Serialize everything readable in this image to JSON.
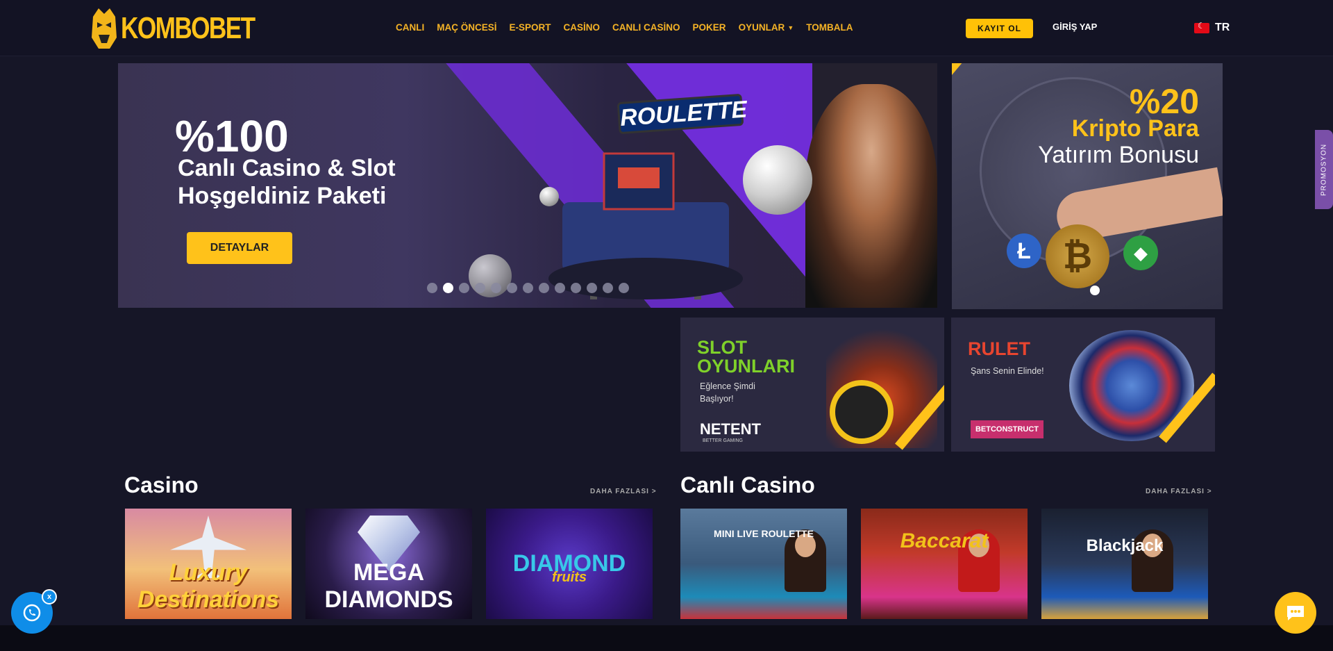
{
  "header": {
    "logo_text": "KOMBOBET",
    "nav": [
      {
        "label": "CANLI"
      },
      {
        "label": "MAÇ ÖNCESİ"
      },
      {
        "label": "E-SPORT"
      },
      {
        "label": "CASİNO"
      },
      {
        "label": "CANLI CASİNO"
      },
      {
        "label": "POKER"
      },
      {
        "label": "OYUNLAR",
        "dropdown": true
      },
      {
        "label": "TOMBALA"
      }
    ],
    "register_label": "KAYIT OL",
    "login_label": "GİRİŞ YAP",
    "language": "TR"
  },
  "hero": {
    "title": "%100",
    "subtitle_line1": "Canlı Casino & Slot",
    "subtitle_line2": "Hoşgeldiniz Paketi",
    "button_label": "DETAYLAR",
    "machine_sign": "ROULETTE",
    "slide_count": 13,
    "active_slide": 2
  },
  "side_banner": {
    "percent": "%20",
    "line1": "Kripto Para",
    "line2": "Yatırım Bonusu",
    "coins": [
      "Ł",
      "₿",
      "◆"
    ]
  },
  "promos_tab": "PROMOSYON",
  "tiles": {
    "slot": {
      "title1": "SLOT",
      "title2": "OYUNLARI",
      "sub": "Eğlence Şimdi Başlıyor!",
      "brand": "NETENT",
      "brand_sub": "BETTER GAMING"
    },
    "rulet": {
      "title": "RULET",
      "sub": "Şans Senin Elinde!",
      "brand": "BETCONSTRUCT"
    }
  },
  "sections": {
    "casino": {
      "title": "Casino",
      "more": "DAHA FAZLASI >"
    },
    "live": {
      "title": "Canlı Casino",
      "more": "DAHA FAZLASI >"
    }
  },
  "games": {
    "g1": "Luxury Destinations",
    "g2": "MEGA DIAMONDS",
    "g3": "DIAMOND",
    "g3_sub": "fruits",
    "g4": "MINI LIVE ROULETTE",
    "g5": "Baccarat",
    "g6": "Blackjack"
  },
  "widgets": {
    "close": "x"
  },
  "colors": {
    "accent": "#ffc21a",
    "nav": "#f5b326",
    "bg": "#161627"
  }
}
